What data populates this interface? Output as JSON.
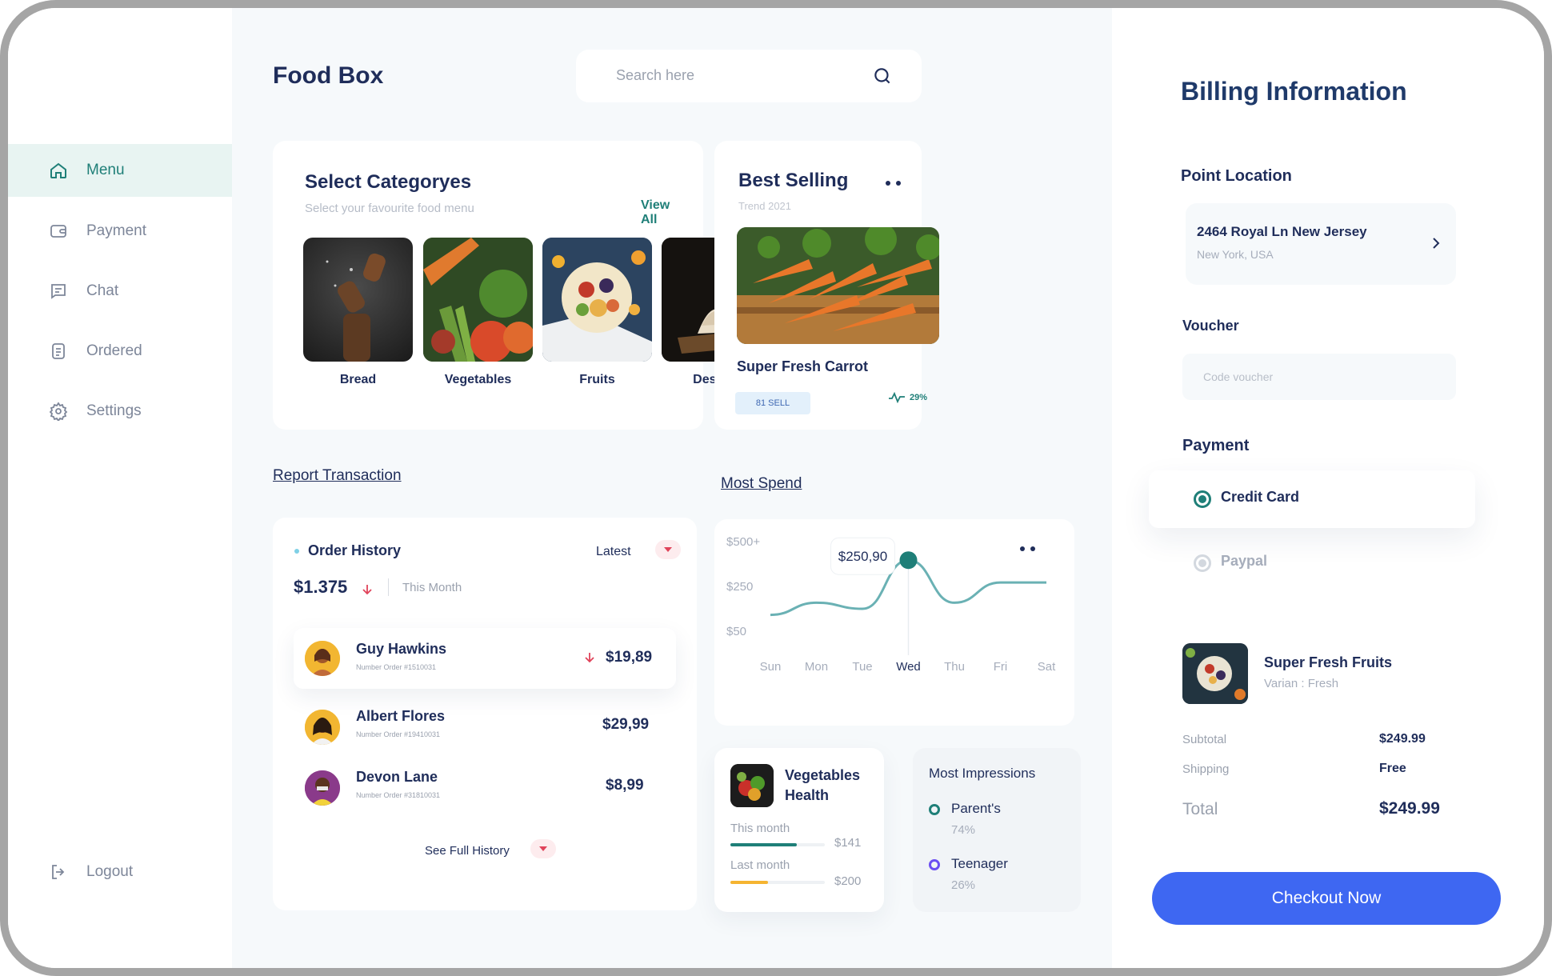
{
  "app": {
    "title": "Food Box"
  },
  "search": {
    "placeholder": "Search here"
  },
  "sidebar": {
    "items": [
      {
        "label": "Menu",
        "icon": "home-icon",
        "active": true
      },
      {
        "label": "Payment",
        "icon": "wallet-icon"
      },
      {
        "label": "Chat",
        "icon": "chat-icon"
      },
      {
        "label": "Ordered",
        "icon": "document-icon"
      },
      {
        "label": "Settings",
        "icon": "gear-icon"
      }
    ],
    "logout": "Logout"
  },
  "categories": {
    "title": "Select Categoryes",
    "subtitle": "Select your favourite food menu",
    "view_all": "View All",
    "items": [
      {
        "label": "Bread"
      },
      {
        "label": "Vegetables"
      },
      {
        "label": "Fruits"
      },
      {
        "label": "Dessert"
      }
    ]
  },
  "best_selling": {
    "title": "Best Selling",
    "subtitle": "Trend 2021",
    "product": "Super Fresh Carrot",
    "sell_badge": "81 SELL",
    "trend": "29%"
  },
  "report": {
    "title": "Report Transaction"
  },
  "most_spend": {
    "title": "Most Spend"
  },
  "order_history": {
    "title": "Order History",
    "filter": "Latest",
    "amount": "$1.375",
    "period": "This Month",
    "orders": [
      {
        "name": "Guy Hawkins",
        "number": "Number Order #1510031",
        "amount": "$19,89"
      },
      {
        "name": "Albert Flores",
        "number": "Number Order #19410031",
        "amount": "$29,99"
      },
      {
        "name": "Devon Lane",
        "number": "Number Order #31810031",
        "amount": "$8,99"
      }
    ],
    "see_full": "See Full History"
  },
  "chart_data": {
    "type": "line",
    "categories": [
      "Sun",
      "Mon",
      "Tue",
      "Wed",
      "Thu",
      "Fri",
      "Sat"
    ],
    "y_ticks": [
      "$500+",
      "$250",
      "$50"
    ],
    "highlight": {
      "category": "Wed",
      "label": "$250,90"
    },
    "series": [
      {
        "values": [
          170,
          230,
          200,
          440,
          230,
          330,
          330
        ]
      }
    ],
    "ylim": [
      50,
      500
    ],
    "color": "#6ab1b4",
    "accent": "#1f7f78"
  },
  "veg_health": {
    "title_line1": "Vegetables",
    "title_line2": "Health",
    "this_month_label": "This month",
    "this_month_value": "$141",
    "this_month_progress": 0.7,
    "last_month_label": "Last month",
    "last_month_value": "$200",
    "last_month_progress": 0.4
  },
  "impressions": {
    "title": "Most Impressions",
    "items": [
      {
        "label": "Parent's",
        "value": "74%",
        "color": "#1f7f78"
      },
      {
        "label": "Teenager",
        "value": "26%",
        "color": "#6b4ef2"
      }
    ]
  },
  "billing": {
    "title": "Billing Information",
    "location_label": "Point Location",
    "address_line1": "2464 Royal Ln New Jersey",
    "address_line2": "New York, USA",
    "voucher_label": "Voucher",
    "voucher_placeholder": "Code voucher",
    "payment_label": "Payment",
    "methods": [
      {
        "label": "Credit Card",
        "selected": true
      },
      {
        "label": "Paypal",
        "selected": false
      }
    ],
    "product_name": "Super Fresh Fruits",
    "product_variant": "Varian : Fresh",
    "subtotal_label": "Subtotal",
    "subtotal_value": "$249.99",
    "shipping_label": "Shipping",
    "shipping_value": "Free",
    "total_label": "Total",
    "total_value": "$249.99",
    "checkout": "Checkout Now"
  },
  "colors": {
    "primary": "#1f7f78",
    "accent_blue": "#3e67f2",
    "navy": "#1f2d5a",
    "down_red": "#e0435a",
    "badge_bg": "#e3f0fb"
  }
}
